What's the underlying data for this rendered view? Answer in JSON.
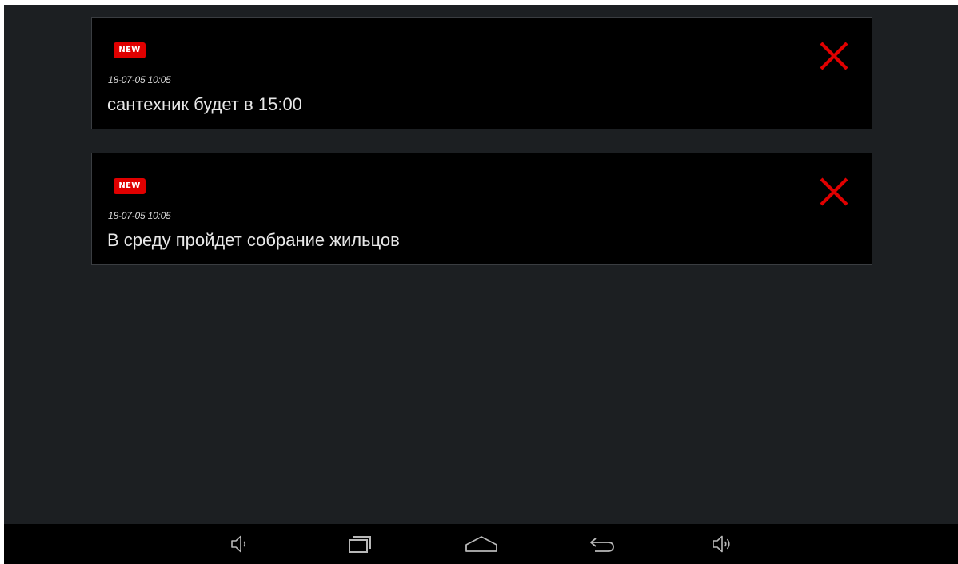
{
  "notifications": [
    {
      "badge": "NEW",
      "timestamp": "18-07-05 10:05",
      "message": "сантехник будет в 15:00",
      "close_icon": "close-icon"
    },
    {
      "badge": "NEW",
      "timestamp": "18-07-05 10:05",
      "message": "В среду пройдет собрание жильцов",
      "close_icon": "close-icon"
    }
  ],
  "navigation_bar": {
    "buttons": [
      "volume-down-icon",
      "recent-apps-icon",
      "home-icon",
      "back-icon",
      "volume-up-icon"
    ]
  },
  "colors": {
    "background": "#1c1f22",
    "card": "#000000",
    "card_border": "#3a3d41",
    "accent_red": "#e00000",
    "text": "#e8e8e8",
    "navbar": "#000000",
    "nav_icon": "#b8b8b8"
  }
}
